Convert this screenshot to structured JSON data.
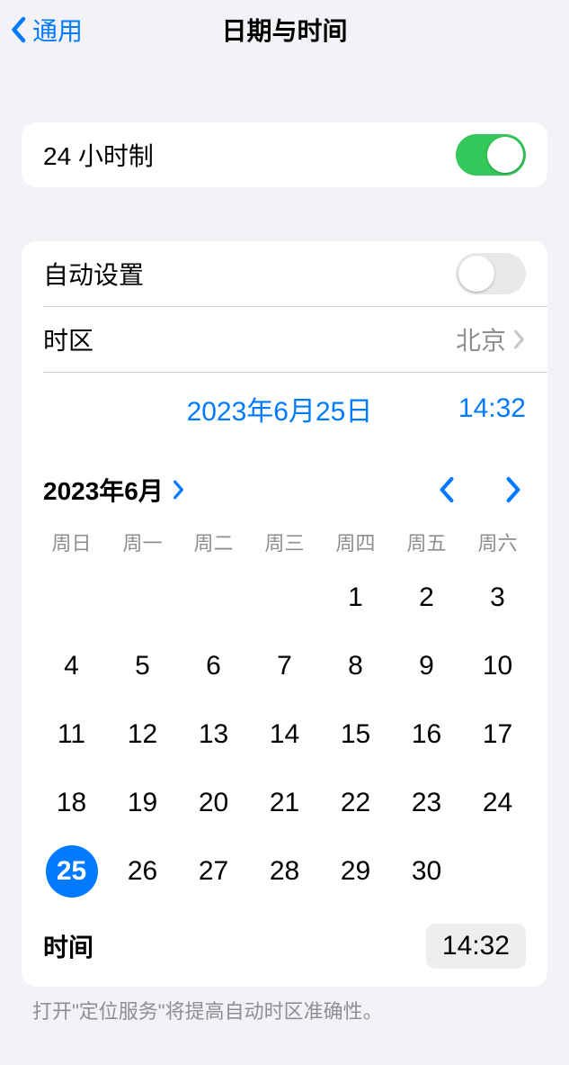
{
  "header": {
    "back_label": "通用",
    "title": "日期与时间"
  },
  "sections": {
    "twenty_four_hour": {
      "label": "24 小时制",
      "enabled": true
    },
    "auto_set": {
      "label": "自动设置",
      "enabled": false
    },
    "timezone": {
      "label": "时区",
      "value": "北京"
    }
  },
  "summary": {
    "date": "2023年6月25日",
    "time": "14:32"
  },
  "calendar": {
    "month_label": "2023年6月",
    "weekdays": [
      "周日",
      "周一",
      "周二",
      "周三",
      "周四",
      "周五",
      "周六"
    ],
    "first_day_index": 4,
    "days": [
      1,
      2,
      3,
      4,
      5,
      6,
      7,
      8,
      9,
      10,
      11,
      12,
      13,
      14,
      15,
      16,
      17,
      18,
      19,
      20,
      21,
      22,
      23,
      24,
      25,
      26,
      27,
      28,
      29,
      30
    ],
    "selected_day": 25
  },
  "time_row": {
    "label": "时间",
    "value": "14:32"
  },
  "footer": {
    "note": "打开\"定位服务\"将提高自动时区准确性。"
  }
}
